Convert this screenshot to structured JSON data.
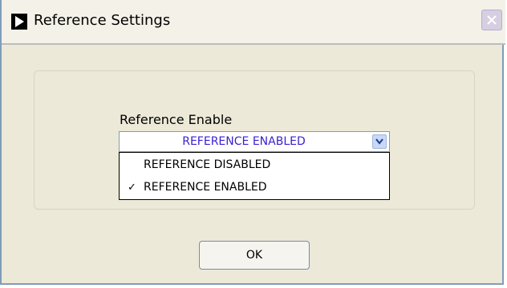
{
  "window": {
    "title": "Reference Settings",
    "icon": "play-arrow-icon",
    "close_icon": "close-icon"
  },
  "form": {
    "field_label": "Reference Enable",
    "selected_value": "REFERENCE ENABLED",
    "options": [
      {
        "label": "REFERENCE DISABLED",
        "checked": false
      },
      {
        "label": "REFERENCE ENABLED",
        "checked": true
      }
    ],
    "check_mark": "✓",
    "accent_color": "#3a1fd0"
  },
  "footer": {
    "ok_label": "OK"
  }
}
